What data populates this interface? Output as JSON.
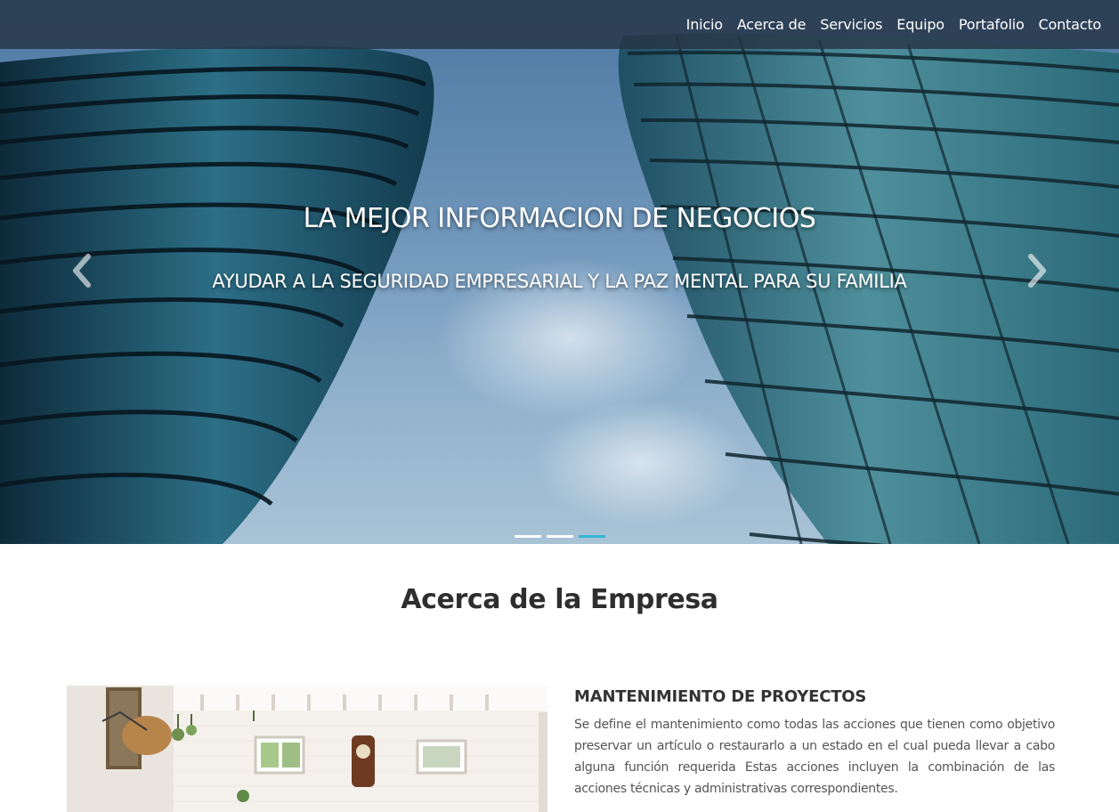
{
  "nav": {
    "items": [
      {
        "label": "Inicio"
      },
      {
        "label": "Acerca de"
      },
      {
        "label": "Servicios"
      },
      {
        "label": "Equipo"
      },
      {
        "label": "Portafolio"
      },
      {
        "label": "Contacto"
      }
    ]
  },
  "hero": {
    "title": "LA MEJOR INFORMACION DE NEGOCIOS",
    "subtitle": "AYUDAR A LA SEGURIDAD EMPRESARIAL Y LA PAZ MENTAL PARA SU FAMILIA",
    "prev_icon": "chevron-left-icon",
    "next_icon": "chevron-right-icon",
    "slides_count": 3,
    "active_slide": 3
  },
  "about": {
    "heading": "Acerca de la Empresa",
    "title": "MANTENIMIENTO DE PROYECTOS",
    "text": "Se define el mantenimiento como todas las acciones que tienen como objetivo preservar un artículo o restaurarlo a un estado en el cual pueda llevar a cabo alguna función requerida Estas acciones incluyen la combinación de las acciones técnicas y administrativas correspondientes."
  },
  "colors": {
    "indicator_active": "#34b7d3",
    "nav_background": "#263446"
  }
}
